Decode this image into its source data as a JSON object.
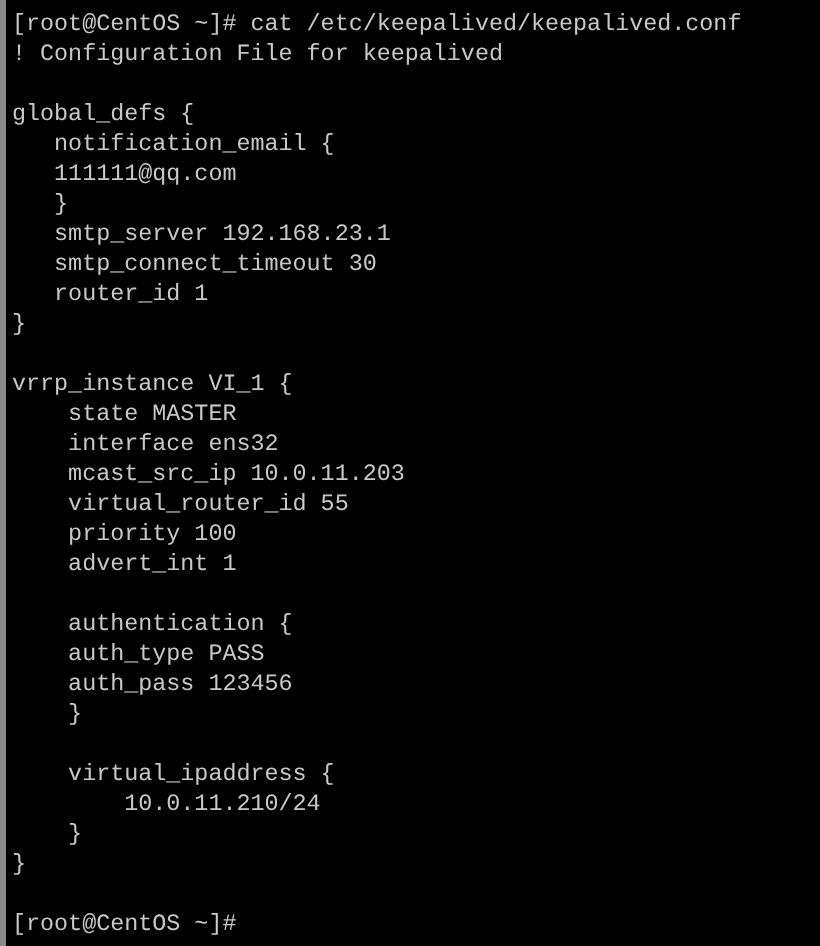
{
  "terminal": {
    "blocks": [
      {
        "lines": [
          "[root@CentOS ~]# cat /etc/keepalived/keepalived.conf",
          "! Configuration File for keepalived"
        ]
      },
      {
        "lines": [
          "global_defs {",
          "   notification_email {",
          "   111111@qq.com",
          "   }",
          "   smtp_server 192.168.23.1",
          "   smtp_connect_timeout 30",
          "   router_id 1",
          "}"
        ]
      },
      {
        "lines": [
          "vrrp_instance VI_1 {",
          "    state MASTER",
          "    interface ens32",
          "    mcast_src_ip 10.0.11.203",
          "    virtual_router_id 55",
          "    priority 100",
          "    advert_int 1"
        ]
      },
      {
        "lines": [
          "    authentication {",
          "    auth_type PASS",
          "    auth_pass 123456",
          "    }"
        ]
      },
      {
        "lines": [
          "    virtual_ipaddress {",
          "        10.0.11.210/24",
          "    }",
          "}"
        ]
      },
      {
        "lines": [
          "[root@CentOS ~]#"
        ]
      }
    ]
  }
}
